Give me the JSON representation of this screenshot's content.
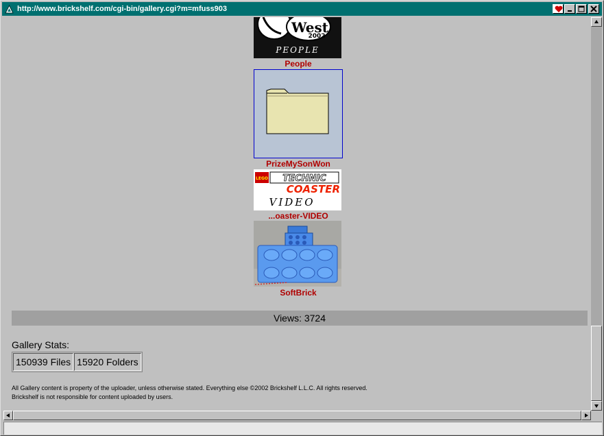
{
  "window": {
    "title": "http://www.brickshelf.com/cgi-bin/gallery.cgi?m=mfuss903"
  },
  "gallery": {
    "items": [
      {
        "label": "People",
        "image_text_line1": "West",
        "image_text_line2": "2002",
        "image_text_line3": "PEOPLE"
      },
      {
        "label": "PrizeMySonWon"
      },
      {
        "label": "...oaster-VIDEO",
        "image_text_technic": "TECHNIC",
        "image_text_coaster": "COASTER",
        "image_text_video": "VIDEO",
        "image_text_lego": "LEGO"
      },
      {
        "label": "SoftBrick"
      }
    ]
  },
  "views": {
    "text": "Views: 3724"
  },
  "stats": {
    "heading": "Gallery Stats:",
    "files": "150939 Files",
    "folders": "15920 Folders"
  },
  "footer": {
    "line1": "All Gallery content is property of the uploader, unless otherwise stated. Everything else ©2002 Brickshelf L.L.C. All rights reserved.",
    "line2": "Brickshelf is not responsible for content uploaded by users."
  },
  "colors": {
    "titlebar": "#007070",
    "label": "#b00000",
    "folder_bg": "#b8c4d4",
    "folder_border": "#0000cc"
  }
}
